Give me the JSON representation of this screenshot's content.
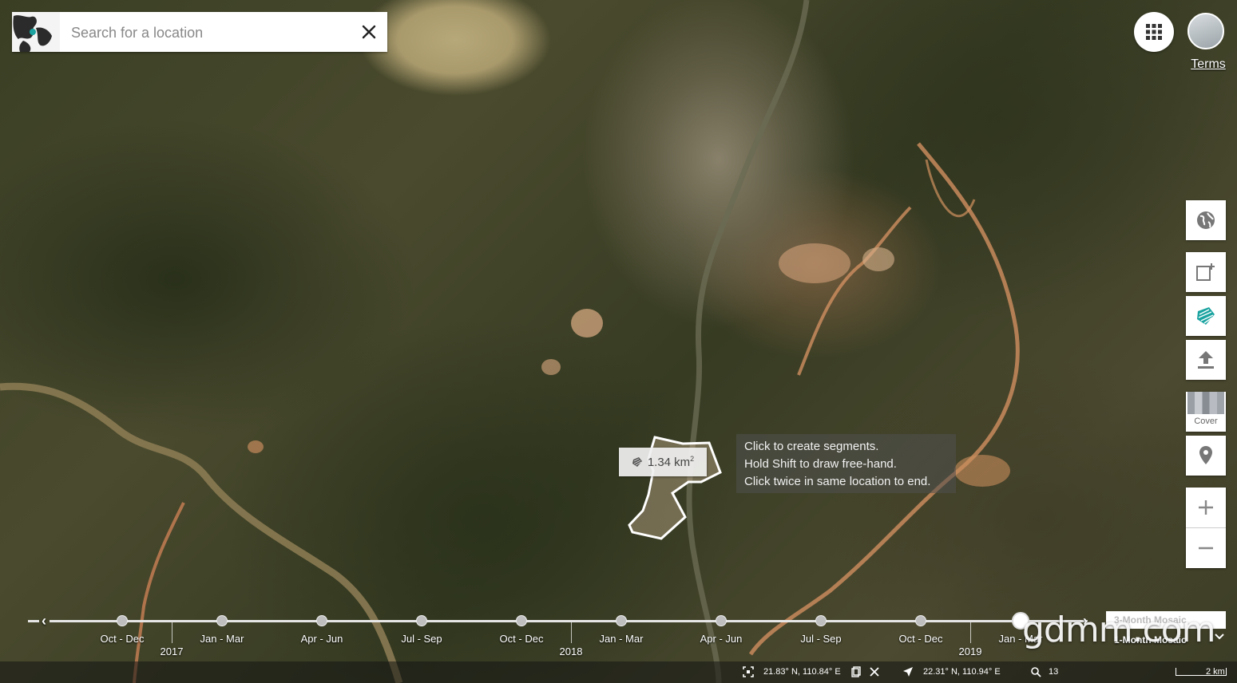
{
  "search": {
    "placeholder": "Search for a location",
    "value": ""
  },
  "header": {
    "terms_label": "Terms"
  },
  "toolbar": {
    "cover_label": "Cover"
  },
  "measure": {
    "area_value": "1.34 km",
    "area_unit_sup": "2",
    "hint_lines": [
      "Click to create segments.",
      "Hold Shift to draw free-hand.",
      "Click twice in same location to end."
    ]
  },
  "timeline": {
    "periods": [
      "Oct - Dec",
      "Jan - Mar",
      "Apr - Jun",
      "Jul - Sep",
      "Oct - Dec",
      "Jan - Mar",
      "Apr - Jun",
      "Jul - Sep",
      "Oct - Dec",
      "Jan - Mar"
    ],
    "years": [
      "2017",
      "2018",
      "2019"
    ],
    "mosaic_options": [
      "3-Month Mosaic",
      "1-Month Mosaic"
    ]
  },
  "watermark": "gdmm.com",
  "statusbar": {
    "center_coords": "21.83° N, 110.84° E",
    "cursor_coords": "22.31° N, 110.94° E",
    "zoom_level": "13",
    "scale_label": "2 km"
  },
  "colors": {
    "accent": "#1aa3a0",
    "polygon_stroke": "#ffffff"
  },
  "icons": {
    "globe_logo": "globe-logo-icon",
    "close": "close-icon",
    "apps": "apps-grid-icon",
    "globe": "globe-icon",
    "add_layer": "add-layer-icon",
    "draw_polygon": "polygon-draw-icon",
    "upload": "upload-icon",
    "pin": "location-pin-icon",
    "zoom_in": "zoom-in-icon",
    "zoom_out": "zoom-out-icon"
  }
}
